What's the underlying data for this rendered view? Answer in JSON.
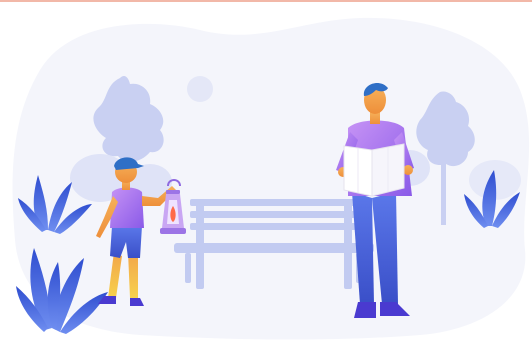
{
  "scene": {
    "description_tags": [
      "park",
      "bench",
      "father",
      "child",
      "map",
      "lantern",
      "trees",
      "plants",
      "sun"
    ],
    "top_rule_color": "#f2b8a8"
  },
  "colors": {
    "background_blob": "#f4f5fb",
    "tree_light": "#c9d0f2",
    "tree_dark": "#a9b4ec",
    "bench": "#c2cbf1",
    "plant_blue": "#3c5fd8",
    "plant_light": "#6f8ef0",
    "shirt_purple": "#b07cf0",
    "pants_blue": "#4a6be0",
    "skin": "#f2a54a",
    "hair_blue": "#2f6fc6",
    "map_white": "#ffffff",
    "lantern": "#b78be6",
    "flame": "#ff6b4a"
  },
  "icons": {
    "sun": "sun-icon",
    "lantern": "lantern-icon",
    "map": "map-icon",
    "bench": "bench-icon"
  }
}
